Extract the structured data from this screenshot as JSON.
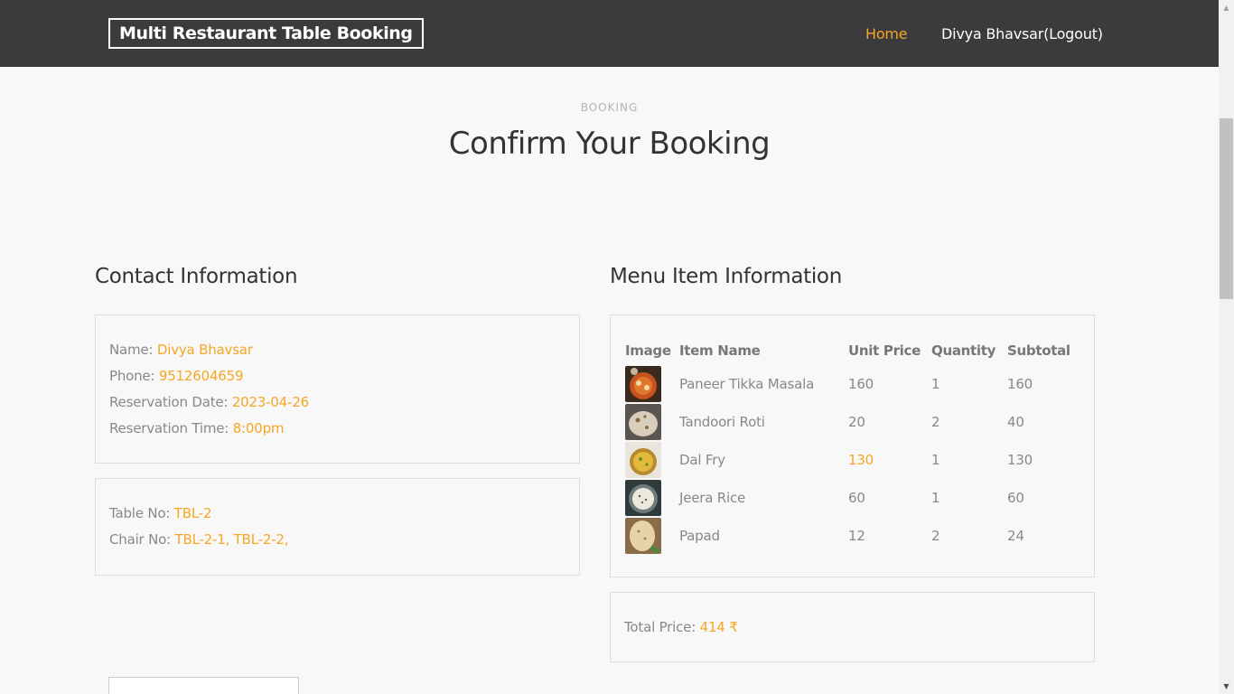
{
  "navbar": {
    "brand": "Multi Restaurant Table Booking",
    "links": {
      "home": "Home",
      "user": "Divya Bhavsar(Logout)"
    }
  },
  "header": {
    "subheading": "BOOKING",
    "title": "Confirm Your Booking"
  },
  "contact": {
    "title": "Contact Information",
    "name_label": "Name:",
    "name": "Divya Bhavsar",
    "phone_label": "Phone:",
    "phone": "9512604659",
    "date_label": "Reservation Date:",
    "date": "2023-04-26",
    "time_label": "Reservation Time:",
    "time": "8:00pm"
  },
  "table_info": {
    "table_label": "Table No:",
    "table": "TBL-2",
    "chair_label": "Chair No:",
    "chairs": "TBL-2-1, TBL-2-2,"
  },
  "menu": {
    "title": "Menu Item Information",
    "columns": [
      "Image",
      "Item Name",
      "Unit Price",
      "Quantity",
      "Subtotal"
    ],
    "items": [
      {
        "icon": "paneer-tikka-masala-image",
        "name": "Paneer Tikka Masala",
        "unit_price": "160",
        "quantity": "1",
        "subtotal": "160"
      },
      {
        "icon": "tandoori-roti-image",
        "name": "Tandoori Roti",
        "unit_price": "20",
        "quantity": "2",
        "subtotal": "40"
      },
      {
        "icon": "dal-fry-image",
        "name": "Dal Fry",
        "unit_price": "130",
        "quantity": "1",
        "subtotal": "130"
      },
      {
        "icon": "jeera-rice-image",
        "name": "Jeera Rice",
        "unit_price": "60",
        "quantity": "1",
        "subtotal": "60"
      },
      {
        "icon": "papad-image",
        "name": "Papad",
        "unit_price": "12",
        "quantity": "2",
        "subtotal": "24"
      }
    ]
  },
  "total": {
    "label": "Total Price:",
    "value": "414 ₹"
  },
  "colors": {
    "navbar_bg": "#3b3b3d",
    "accent": "#f5a623",
    "page_bg": "#f8f8f8"
  }
}
